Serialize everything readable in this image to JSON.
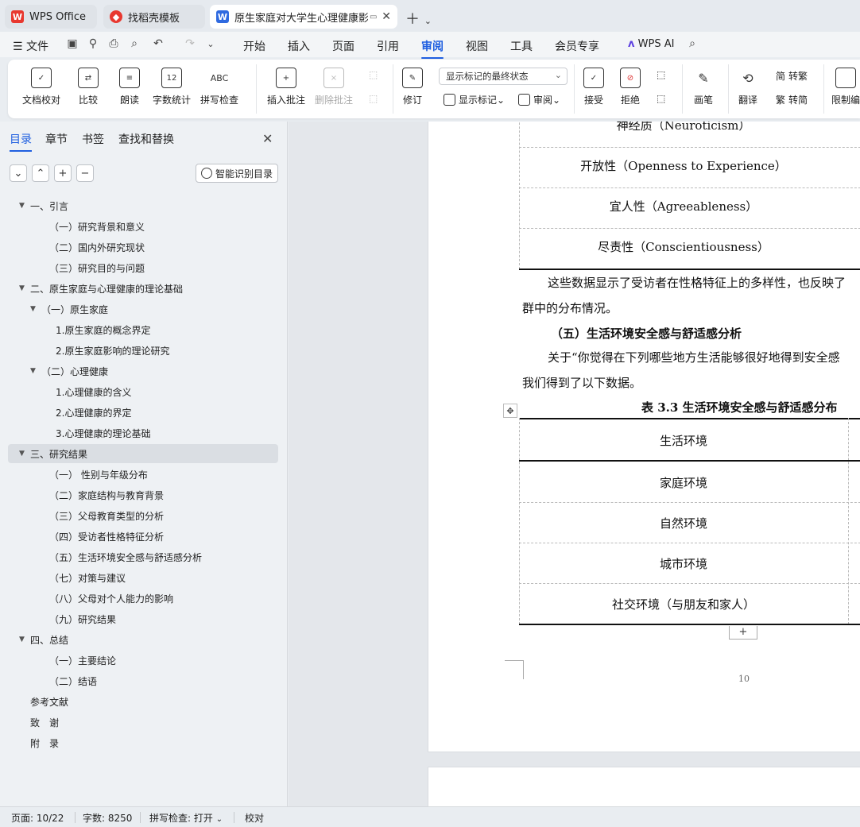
{
  "titlebar": {
    "tabs": [
      {
        "label": "WPS Office",
        "icon": "wps-logo-icon"
      },
      {
        "label": "找稻壳模板",
        "icon": "docer-logo-icon"
      },
      {
        "label": "原生家庭对大学生心理健康影响",
        "icon": "writer-doc-icon"
      }
    ]
  },
  "menubar": {
    "file": "文件",
    "items": [
      "开始",
      "插入",
      "页面",
      "引用",
      "审阅",
      "视图",
      "工具",
      "会员专享"
    ],
    "active": "审阅",
    "ai": "WPS AI"
  },
  "ribbon": {
    "doc_check": "文档校对",
    "compare": "比较",
    "read_aloud": "朗读",
    "word_count": "字数统计",
    "word_count_icon_text": "12",
    "spell_check": "拼写检查",
    "spell_icon_text": "ABC",
    "insert_comment": "插入批注",
    "delete_comment": "删除批注",
    "track_changes": "修订",
    "markup_mode": "显示标记的最终状态",
    "show_markup": "显示标记",
    "review_pane": "审阅",
    "accept": "接受",
    "reject": "拒绝",
    "pen": "画笔",
    "translate": "翻译",
    "to_traditional": "转繁",
    "to_simplified": "转简",
    "to_traditional_icon": "简",
    "to_simplified_icon": "繁",
    "restrict": "限制编"
  },
  "navpane": {
    "tabs": [
      "目录",
      "章节",
      "书签",
      "查找和替换"
    ],
    "smart_button": "智能识别目录",
    "toc": [
      {
        "label": "一、引言",
        "level": 0,
        "arrow": true
      },
      {
        "label": "（一）研究背景和意义",
        "level": 1,
        "arrow": false
      },
      {
        "label": "（二）国内外研究现状",
        "level": 1,
        "arrow": false
      },
      {
        "label": "（三）研究目的与问题",
        "level": 1,
        "arrow": false
      },
      {
        "label": "二、原生家庭与心理健康的理论基础",
        "level": 0,
        "arrow": true
      },
      {
        "label": "（一）原生家庭",
        "level": 1,
        "arrow": true
      },
      {
        "label": "1.原生家庭的概念界定",
        "level": 2,
        "arrow": false
      },
      {
        "label": "2.原生家庭影响的理论研究",
        "level": 2,
        "arrow": false
      },
      {
        "label": "（二）心理健康",
        "level": 1,
        "arrow": true
      },
      {
        "label": "1.心理健康的含义",
        "level": 2,
        "arrow": false
      },
      {
        "label": "2.心理健康的界定",
        "level": 2,
        "arrow": false
      },
      {
        "label": "3.心理健康的理论基础",
        "level": 2,
        "arrow": false
      },
      {
        "label": "三、研究结果",
        "level": 0,
        "arrow": true,
        "selected": true
      },
      {
        "label": "（一）  性别与年级分布",
        "level": 1,
        "arrow": false
      },
      {
        "label": "（二）家庭结构与教育背景",
        "level": 1,
        "arrow": false
      },
      {
        "label": "（三）父母教育类型的分析",
        "level": 1,
        "arrow": false
      },
      {
        "label": "（四）受访者性格特征分析",
        "level": 1,
        "arrow": false
      },
      {
        "label": "（五）生活环境安全感与舒适感分析",
        "level": 1,
        "arrow": false
      },
      {
        "label": "（七）对策与建议",
        "level": 1,
        "arrow": false
      },
      {
        "label": "（八）父母对个人能力的影响",
        "level": 1,
        "arrow": false
      },
      {
        "label": "（九）研究结果",
        "level": 1,
        "arrow": false
      },
      {
        "label": "四、总结",
        "level": 0,
        "arrow": true
      },
      {
        "label": "（一）主要结论",
        "level": 1,
        "arrow": false
      },
      {
        "label": "（二）结语",
        "level": 1,
        "arrow": false
      },
      {
        "label": "参考文献",
        "level": 0,
        "arrow": false
      },
      {
        "label": "致　谢",
        "level": 0,
        "arrow": false
      },
      {
        "label": "附　录",
        "level": 0,
        "arrow": false
      }
    ]
  },
  "document": {
    "table1_rows": [
      "神经质（Neuroticism）",
      "开放性（Openness to Experience）",
      "宜人性（Agreeableness）",
      "尽责性（Conscientiousness）"
    ],
    "para1_line1": "这些数据显示了受访者在性格特征上的多样性，也反映了",
    "para1_line2": "群中的分布情况。",
    "heading5": "（五）生活环境安全感与舒适感分析",
    "para2_line1": "关于“你觉得在下列哪些地方生活能够很好地得到安全感",
    "para2_line2": "我们得到了以下数据。",
    "table2_caption": "表 3.3  生活环境安全感与舒适感分布",
    "table2_header": "生活环境",
    "table2_rows": [
      "家庭环境",
      "自然环境",
      "城市环境",
      "社交环境（与朋友和家人）"
    ],
    "add_row": "+",
    "page_number": "10"
  },
  "statusbar": {
    "page": "页面: 10/22",
    "words": "字数: 8250",
    "spell": "拼写检查: 打开",
    "proof": "校对"
  }
}
